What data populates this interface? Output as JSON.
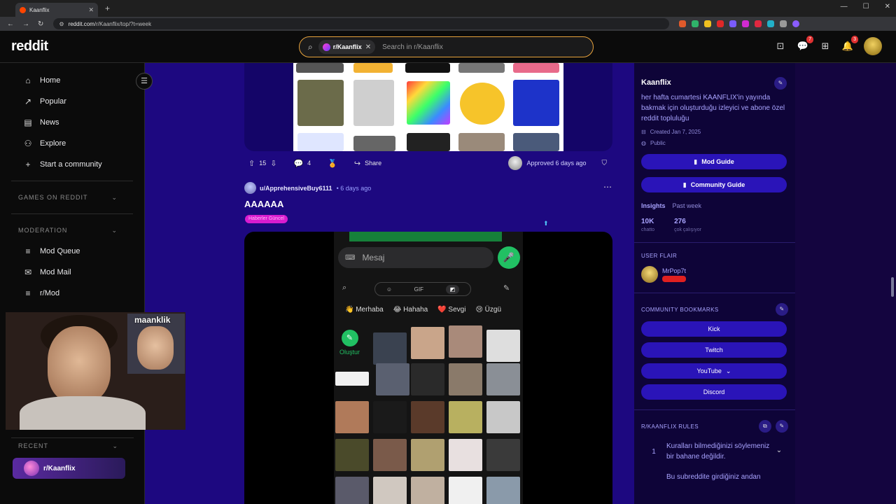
{
  "browser": {
    "tab_title": "Kaanflix",
    "url_host": "reddit.com",
    "url_path": "/r/Kaanflix/top/?t=week"
  },
  "header": {
    "logo": "reddit",
    "search_chip": "r/Kaanflix",
    "search_placeholder": "Search in r/Kaanflix",
    "chat_badge": "7",
    "notif_badge": "3"
  },
  "sidebar": {
    "nav": [
      {
        "label": "Home",
        "icon": "home-icon"
      },
      {
        "label": "Popular",
        "icon": "popular-icon"
      },
      {
        "label": "News",
        "icon": "news-icon"
      },
      {
        "label": "Explore",
        "icon": "explore-icon"
      },
      {
        "label": "Start a community",
        "icon": "plus-icon"
      }
    ],
    "games_header": "GAMES ON REDDIT",
    "moderation_header": "MODERATION",
    "moderation": [
      {
        "label": "Mod Queue",
        "icon": "mod-queue-icon"
      },
      {
        "label": "Mod Mail",
        "icon": "mail-icon"
      },
      {
        "label": "r/Mod",
        "icon": "mod-icon"
      }
    ],
    "recent_header": "RECENT",
    "recent_item": "r/Kaanflix"
  },
  "webcam": {
    "inset_label": "maanklik"
  },
  "post1": {
    "upvotes": "15",
    "comments": "4",
    "share": "Share",
    "approved": "Approved 6 days ago"
  },
  "post2": {
    "author": "u/ApprehensiveBuy6111",
    "time": "• 6 days ago",
    "title": "AAAAAA",
    "flair": "Haberler Güncel",
    "phone": {
      "message_placeholder": "Mesaj",
      "gif_label": "GIF",
      "chips": [
        "👋 Merhaba",
        "😂 Hahaha",
        "❤️ Sevgi",
        "😢 Üzgü"
      ],
      "create_label": "Oluştur"
    }
  },
  "community": {
    "title": "Kaanflix",
    "description": "her hafta cumartesi KAANFLIX'in yayında bakmak için oluşturduğu izleyici ve abone özel reddit topluluğu",
    "created": "Created Jan 7, 2025",
    "visibility": "Public",
    "mod_guide": "Mod Guide",
    "community_guide": "Community Guide",
    "insights_label": "Insights",
    "insights_period": "Past week",
    "stat1_value": "10K",
    "stat1_label": "chatto",
    "stat2_value": "276",
    "stat2_label": "çok çalışıyor",
    "user_flair_header": "USER FLAIR",
    "user_flair_name": "MrPop7t",
    "bookmarks_header": "COMMUNITY BOOKMARKS",
    "bookmarks": [
      "Kick",
      "Twitch",
      "YouTube",
      "Discord"
    ],
    "rules_header": "R/KAANFLIX RULES",
    "rule1_num": "1",
    "rule1_text": "Kuralları bilmediğinizi söylemeniz bir bahane değildir.",
    "rule2_text": "Bu subreddite girdiğiniz andan"
  },
  "colors": {
    "main_bg": "#1d0880",
    "accent_pill": "#2a14b8",
    "search_border": "#e8a33c",
    "flair": "#d81ccf"
  }
}
